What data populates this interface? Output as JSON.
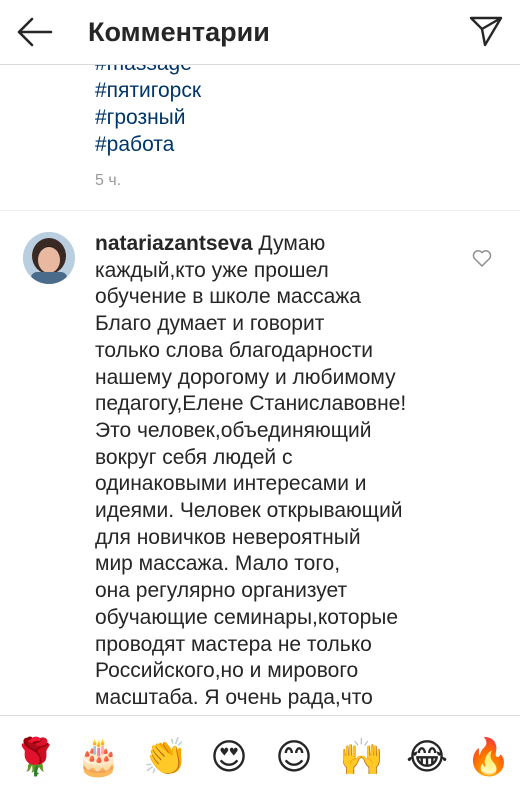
{
  "header": {
    "title": "Комментарии"
  },
  "caption": {
    "hashtags": [
      "#massage",
      "#пятигорск",
      "#грозный",
      "#работа"
    ],
    "time": "5 ч."
  },
  "comment": {
    "username": "natariazantseva",
    "text": " Думаю\nкаждый,кто уже прошел\nобучение в школе массажа\nБлаго думает и говорит\nтолько слова благодарности\nнашему дорогому и любимому\nпедагогу,Елене Станиславовне!\nЭто человек,объединяющий\nвокруг себя людей с\nодинаковыми интересами и\nидеями. Человек открывающий\nдля новичков невероятный\nмир массажа. Мало того,\nона регулярно организует\nобучающие семинары,которые\nпроводят мастера не только\nРоссийского,но и мирового\nмасштаба. Я очень рада,что"
  },
  "emoji_bar": {
    "items": [
      {
        "name": "rose",
        "glyph": "🌹"
      },
      {
        "name": "birthday-cake",
        "glyph": "🎂"
      },
      {
        "name": "clapping-hands",
        "glyph": "👏"
      },
      {
        "name": "heart-eyes",
        "glyph": "😍"
      },
      {
        "name": "smiling-face",
        "glyph": "😊"
      },
      {
        "name": "raising-hands",
        "glyph": "🙌"
      },
      {
        "name": "tears-of-joy",
        "glyph": "😂"
      },
      {
        "name": "fire",
        "glyph": "🔥"
      }
    ]
  }
}
